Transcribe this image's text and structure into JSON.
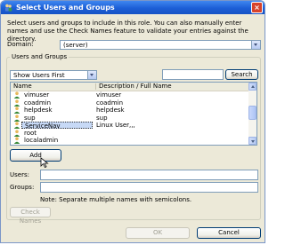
{
  "window": {
    "title": "Select Users and Groups",
    "close_glyph": "×"
  },
  "description": "Select users and groups to include in this role. You can also manually enter names and use the Check Names feature to validate your entries against the directory.",
  "domain": {
    "label": "Domain:",
    "value": "(server)"
  },
  "users_and_groups": {
    "title": "Users and Groups",
    "filter": {
      "value": "Show Users First"
    },
    "search_value": "",
    "search_label": "Search",
    "columns": [
      "Name",
      "Description / Full Name"
    ],
    "rows": [
      {
        "name": "vimuser",
        "description": "vimuser",
        "type": "user"
      },
      {
        "name": "coadmin",
        "description": "coadmin",
        "type": "user"
      },
      {
        "name": "helpdesk",
        "description": "helpdesk",
        "type": "user"
      },
      {
        "name": "sup",
        "description": "sup",
        "type": "user"
      },
      {
        "name": "ServiceNav",
        "description": "Linux User,,,",
        "type": "user",
        "selected": true
      },
      {
        "name": "root",
        "description": "",
        "type": "user"
      },
      {
        "name": "localadmin",
        "description": "",
        "type": "user"
      }
    ],
    "add_label": "Add",
    "users_label": "Users:",
    "users_value": "",
    "groups_label": "Groups:",
    "groups_value": "",
    "note": "Note: Separate multiple names with semicolons.",
    "check_names_label": "Check Names"
  },
  "footer": {
    "ok_label": "OK",
    "cancel_label": "Cancel"
  },
  "colors": {
    "titlebar": "#1c5fd6",
    "selection": "#c7d9f6",
    "dialog_bg": "#ece9d8"
  }
}
